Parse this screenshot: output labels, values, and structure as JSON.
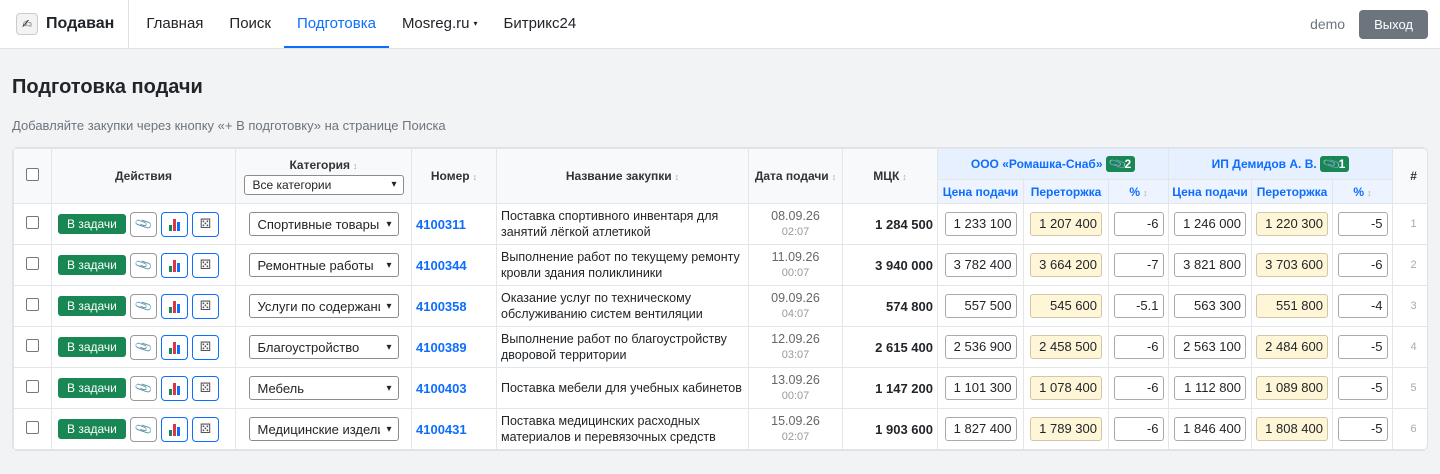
{
  "navbar": {
    "brand": "Подаван",
    "items": [
      {
        "label": "Главная",
        "active": false
      },
      {
        "label": "Поиск",
        "active": false
      },
      {
        "label": "Подготовка",
        "active": true
      },
      {
        "label": "Mosreg.ru",
        "active": false,
        "dropdown": true
      },
      {
        "label": "Битрикс24",
        "active": false
      }
    ],
    "user": "demo",
    "logout_label": "Выход"
  },
  "page": {
    "title": "Подготовка подачи",
    "hint": "Добавляйте закупки через кнопку «+ В подготовку» на странице Поиска"
  },
  "table": {
    "headers": {
      "actions": "Действия",
      "category": "Категория",
      "category_filter": "Все категории",
      "number": "Номер",
      "name": "Название закупки",
      "date": "Дата подачи",
      "mck": "МЦК",
      "rownum": "#"
    },
    "suppliers": [
      {
        "name": "ООО «Ромашка-Снаб»",
        "badge": "2",
        "cols": [
          "Цена подачи",
          "Переторжка",
          "%"
        ]
      },
      {
        "name": "ИП Демидов А. В.",
        "badge": "1",
        "cols": [
          "Цена подачи",
          "Переторжка",
          "%"
        ]
      }
    ],
    "task_label": "В задачи",
    "rows": [
      {
        "category": "Спортивные товары",
        "number": "4100311",
        "name": "Поставка спортивного инвентаря для занятий лёгкой атлетикой",
        "date": "08.09.26",
        "time": "02:07",
        "mck": "1 284 500",
        "s1": [
          "1 233 100",
          "1 207 400",
          "-6"
        ],
        "s2": [
          "1 246 000",
          "1 220 300",
          "-5"
        ],
        "n": "1"
      },
      {
        "category": "Ремонтные работы",
        "number": "4100344",
        "name": "Выполнение работ по текущему ремонту кровли здания поликлиники",
        "date": "11.09.26",
        "time": "00:07",
        "mck": "3 940 000",
        "s1": [
          "3 782 400",
          "3 664 200",
          "-7"
        ],
        "s2": [
          "3 821 800",
          "3 703 600",
          "-6"
        ],
        "n": "2"
      },
      {
        "category": "Услуги по содержани",
        "number": "4100358",
        "name": "Оказание услуг по техническому обслуживанию систем вентиляции",
        "date": "09.09.26",
        "time": "04:07",
        "mck": "574 800",
        "s1": [
          "557 500",
          "545 600",
          "-5.1"
        ],
        "s2": [
          "563 300",
          "551 800",
          "-4"
        ],
        "n": "3"
      },
      {
        "category": "Благоустройство",
        "number": "4100389",
        "name": "Выполнение работ по благоустройству дворовой территории",
        "date": "12.09.26",
        "time": "03:07",
        "mck": "2 615 400",
        "s1": [
          "2 536 900",
          "2 458 500",
          "-6"
        ],
        "s2": [
          "2 563 100",
          "2 484 600",
          "-5"
        ],
        "n": "4"
      },
      {
        "category": "Мебель",
        "number": "4100403",
        "name": "Поставка мебели для учебных кабинетов",
        "date": "13.09.26",
        "time": "00:07",
        "mck": "1 147 200",
        "s1": [
          "1 101 300",
          "1 078 400",
          "-6"
        ],
        "s2": [
          "1 112 800",
          "1 089 800",
          "-5"
        ],
        "n": "5"
      },
      {
        "category": "Медицинские издели",
        "number": "4100431",
        "name": "Поставка медицинских расходных материалов и перевязочных средств",
        "date": "15.09.26",
        "time": "02:07",
        "mck": "1 903 600",
        "s1": [
          "1 827 400",
          "1 789 300",
          "-6"
        ],
        "s2": [
          "1 846 400",
          "1 808 400",
          "-5"
        ],
        "n": "6"
      }
    ]
  },
  "colors": {
    "accent": "#0d6efd",
    "success": "#198754",
    "muted": "#6c757d",
    "highlight": "#fff6d8"
  }
}
